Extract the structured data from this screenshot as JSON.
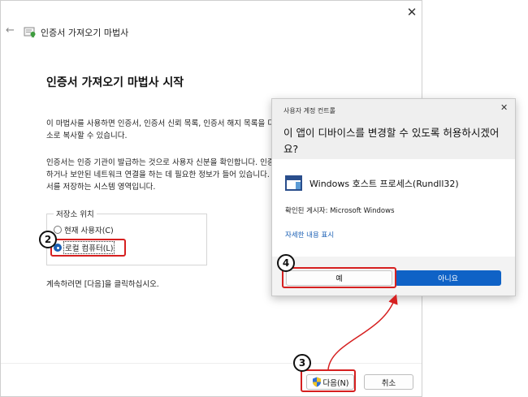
{
  "wizard": {
    "title": "인증서 가져오기 마법사",
    "heading": "인증서 가져오기 마법사 시작",
    "para1": "이 마법사를 사용하면 인증서, 인증서 신뢰 목록, 인증서 해지 목록을 디스크에서 인증서 저장소로\n소로 복사할 수 있습니다.",
    "para2": "인증서는 인증 기관이 발급하는 것으로 사용자 신분을 확인합니다. 인증서에는 데이터를 보호\n하거나 보안된 네트워크 연결을 하는 데 필요한 정보가 들어 있습니다. 인증서 저장소는 인증\n서를 저장하는 시스템 영역입니다.",
    "store_group_label": "저장소 위치",
    "option_current_user": "현재 사용자(C)",
    "option_local_machine": "로컬 컴퓨터(L)",
    "continue_text": "계속하려면 [다음]을 클릭하십시오.",
    "next_button": "다음(N)",
    "cancel_button": "취소"
  },
  "uac": {
    "caption": "사용자 계정 컨트롤",
    "question": "이 앱이 디바이스를 변경할 수 있도록 허용하시겠어요?",
    "program_name": "Windows 호스트 프로세스(Rundll32)",
    "publisher": "확인된 게시자: Microsoft Windows",
    "details_link": "자세한 내용 표시",
    "yes_button": "예",
    "no_button": "아니요"
  },
  "steps": {
    "step2": "2",
    "step3": "3",
    "step4": "4"
  },
  "colors": {
    "highlight": "#d62020",
    "primary_button": "#0f62c6",
    "link": "#1a5fb4"
  },
  "icons": [
    "back-arrow-icon",
    "certificate-icon",
    "close-icon",
    "shield-icon",
    "program-icon"
  ]
}
